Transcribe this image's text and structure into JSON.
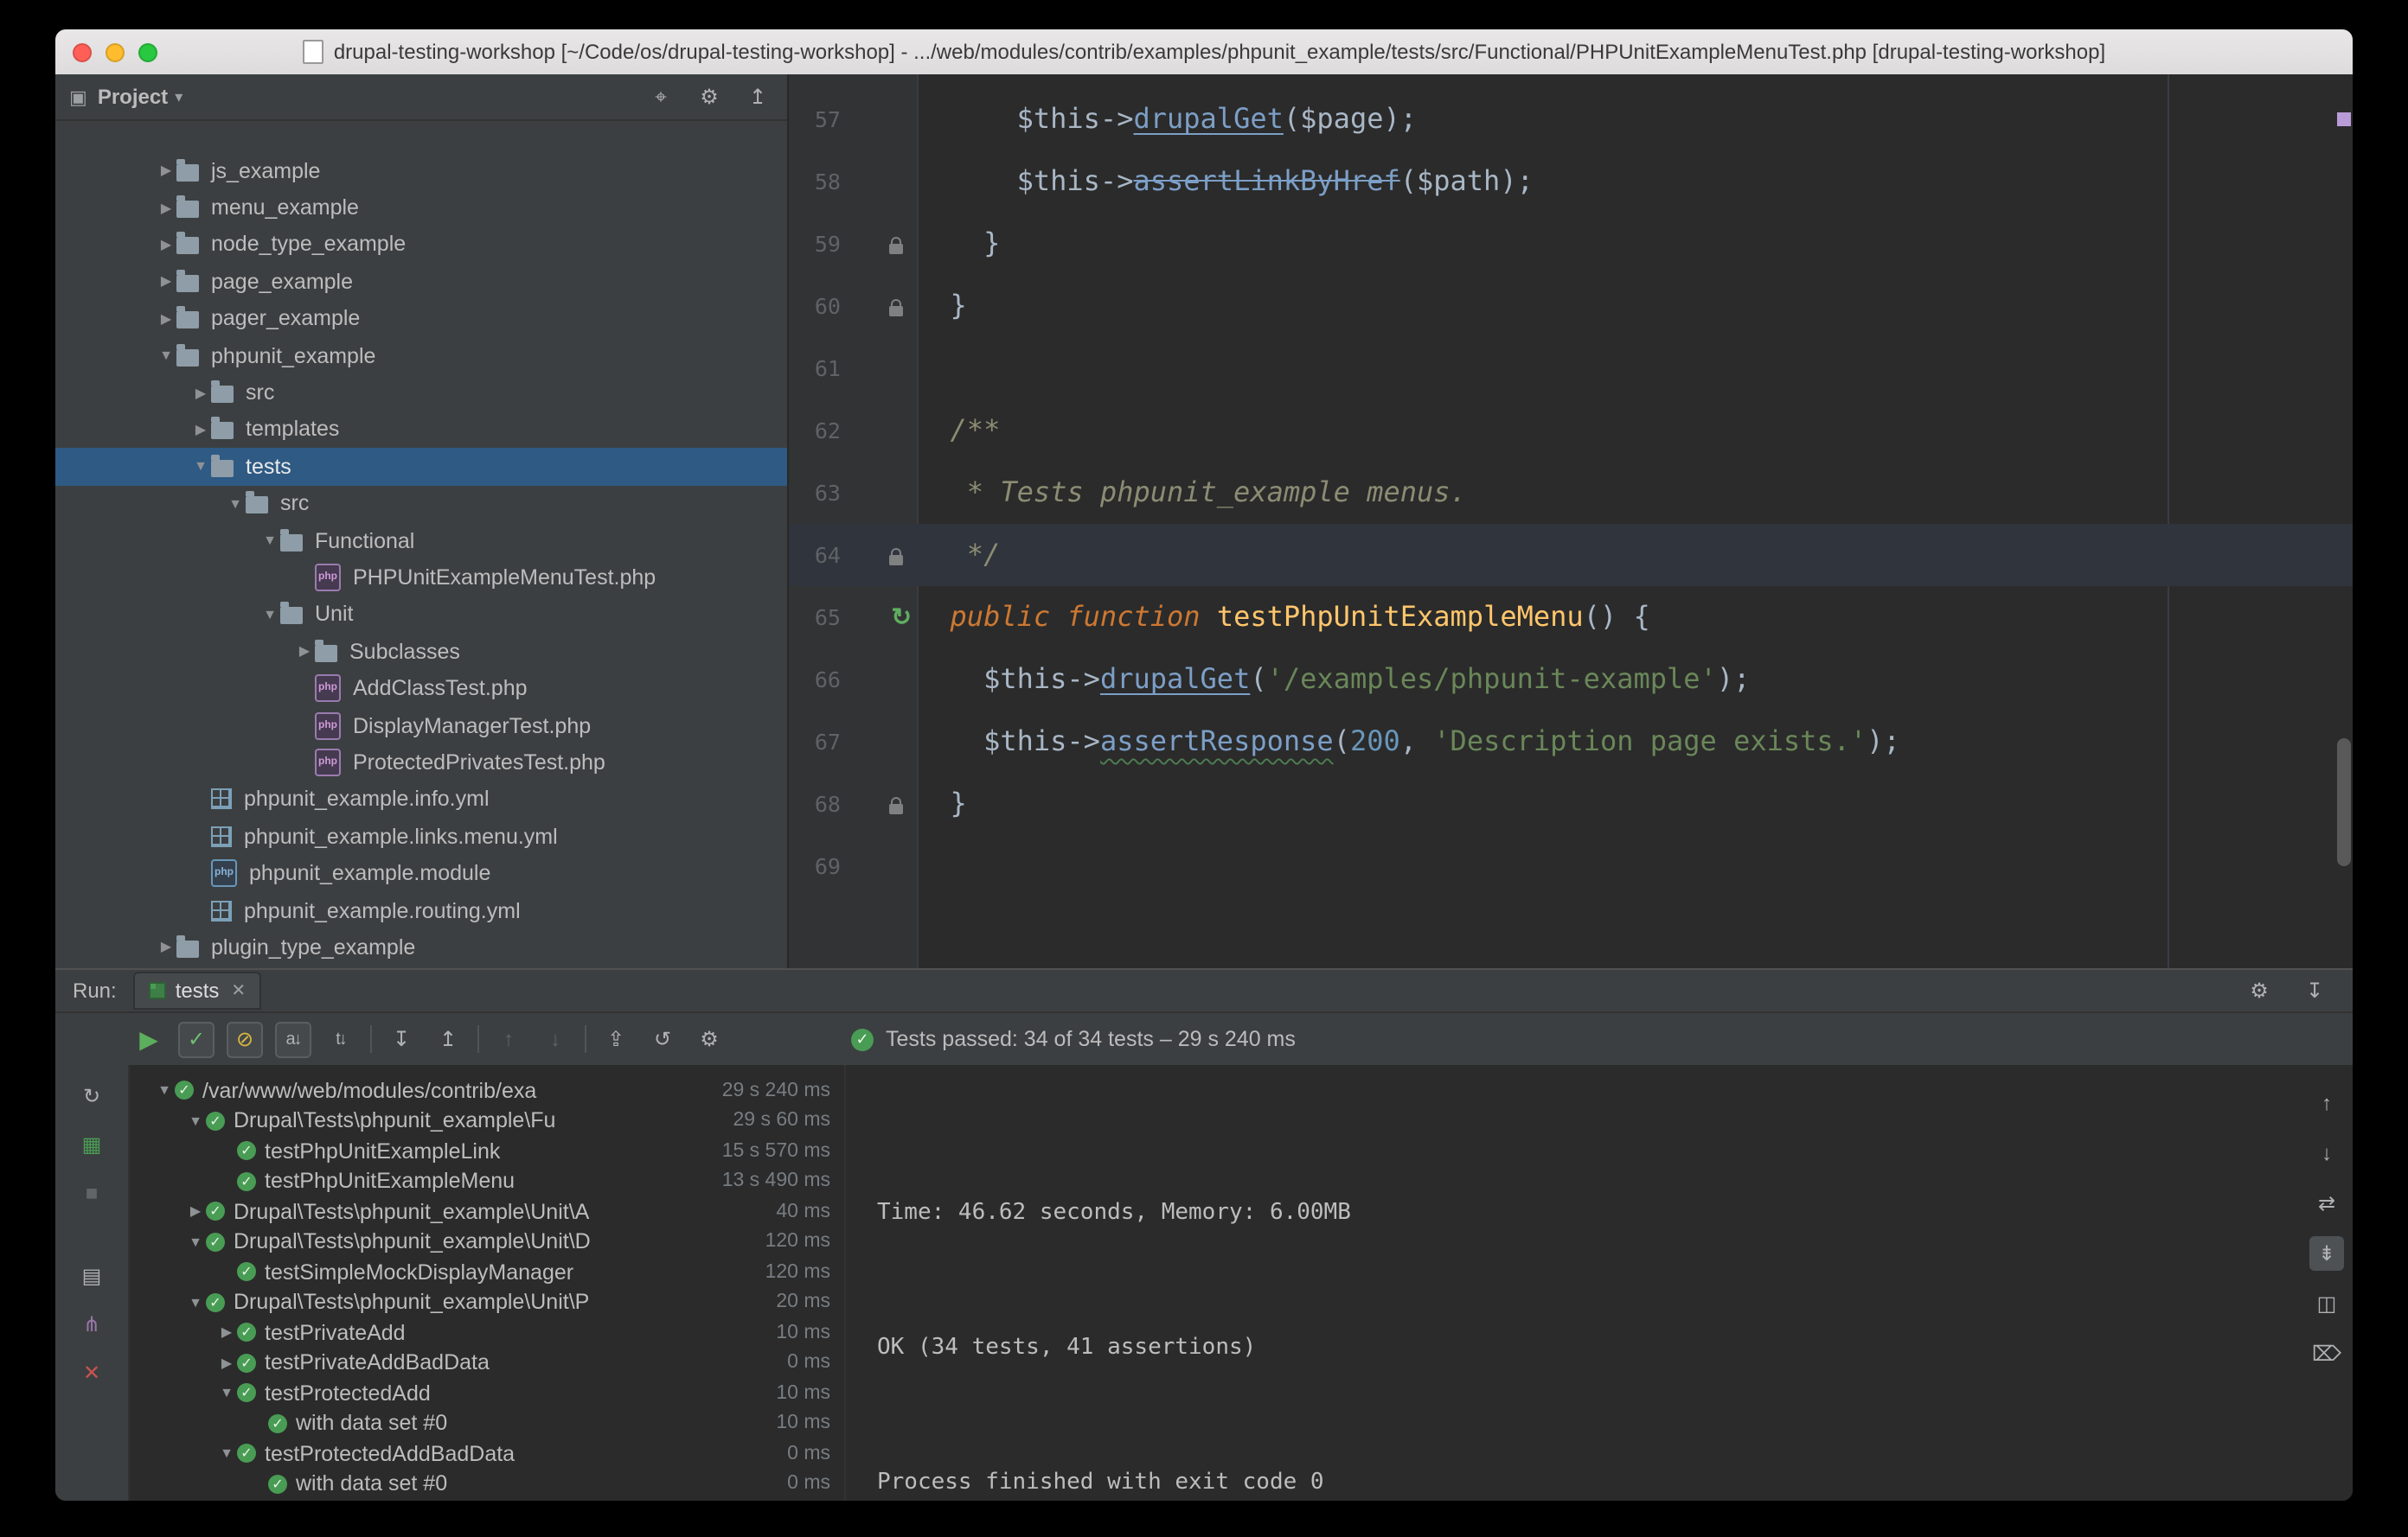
{
  "window": {
    "title": "drupal-testing-workshop [~/Code/os/drupal-testing-workshop] - .../web/modules/contrib/examples/phpunit_example/tests/src/Functional/PHPUnitExampleMenuTest.php [drupal-testing-workshop]"
  },
  "colors": {
    "traffic_close": "#ff5f57",
    "traffic_minimize": "#febc2e",
    "traffic_zoom": "#28c840",
    "selection_blue": "#2e5a84",
    "test_pass_green": "#499c54",
    "editor_bg": "#2b2b2b",
    "panel_bg": "#3c3f41",
    "error_stripe_mark": "#b99bd8"
  },
  "ui": {
    "arrow_open": "▼",
    "arrow_closed": "▶",
    "pass_icon": "✓",
    "php_badge": "php",
    "run_gutter_icon": "↻"
  },
  "project_panel": {
    "header": {
      "tool_icon": "▣",
      "title": "Project",
      "caret": "▾",
      "icons": [
        {
          "name": "locate-file-button",
          "glyph": "⌖"
        },
        {
          "name": "settings-button",
          "glyph": "⚙"
        },
        {
          "name": "collapse-all-button",
          "glyph": "↥"
        }
      ]
    },
    "tree": [
      {
        "label": "js_example",
        "depth": 0,
        "icon": "folder",
        "expand": "closed"
      },
      {
        "label": "menu_example",
        "depth": 0,
        "icon": "folder",
        "expand": "closed"
      },
      {
        "label": "node_type_example",
        "depth": 0,
        "icon": "folder",
        "expand": "closed"
      },
      {
        "label": "page_example",
        "depth": 0,
        "icon": "folder",
        "expand": "closed"
      },
      {
        "label": "pager_example",
        "depth": 0,
        "icon": "folder",
        "expand": "closed"
      },
      {
        "label": "phpunit_example",
        "depth": 0,
        "icon": "folder",
        "expand": "open"
      },
      {
        "label": "src",
        "depth": 1,
        "icon": "folder",
        "expand": "closed"
      },
      {
        "label": "templates",
        "depth": 1,
        "icon": "folder",
        "expand": "closed"
      },
      {
        "label": "tests",
        "depth": 1,
        "icon": "folder",
        "expand": "open",
        "selected": true
      },
      {
        "label": "src",
        "depth": 2,
        "icon": "folder",
        "expand": "open"
      },
      {
        "label": "Functional",
        "depth": 3,
        "icon": "folder",
        "expand": "open"
      },
      {
        "label": "PHPUnitExampleMenuTest.php",
        "depth": 4,
        "icon": "php",
        "expand": "none"
      },
      {
        "label": "Unit",
        "depth": 3,
        "icon": "folder",
        "expand": "open"
      },
      {
        "label": "Subclasses",
        "depth": 4,
        "icon": "folder",
        "expand": "closed"
      },
      {
        "label": "AddClassTest.php",
        "depth": 4,
        "icon": "php",
        "expand": "none"
      },
      {
        "label": "DisplayManagerTest.php",
        "depth": 4,
        "icon": "php",
        "expand": "none"
      },
      {
        "label": "ProtectedPrivatesTest.php",
        "depth": 4,
        "icon": "php",
        "expand": "none"
      },
      {
        "label": "phpunit_example.info.yml",
        "depth": 1,
        "icon": "yml",
        "expand": "none"
      },
      {
        "label": "phpunit_example.links.menu.yml",
        "depth": 1,
        "icon": "yml",
        "expand": "none"
      },
      {
        "label": "phpunit_example.module",
        "depth": 1,
        "icon": "module",
        "expand": "none"
      },
      {
        "label": "phpunit_example.routing.yml",
        "depth": 1,
        "icon": "yml",
        "expand": "none"
      },
      {
        "label": "plugin_type_example",
        "depth": 0,
        "icon": "folder",
        "expand": "closed"
      }
    ]
  },
  "editor": {
    "lines": [
      {
        "num": "57",
        "gutter": "",
        "segments": [
          [
            "      $this->",
            "p"
          ],
          [
            "drupalGet",
            "mu"
          ],
          [
            "($page);",
            "p"
          ]
        ]
      },
      {
        "num": "58",
        "gutter": "",
        "segments": [
          [
            "      $this->",
            "p"
          ],
          [
            "assertLinkByHref",
            "ms"
          ],
          [
            "($path);",
            "p"
          ]
        ]
      },
      {
        "num": "59",
        "gutter": "lock",
        "segments": [
          [
            "    }",
            "p"
          ]
        ]
      },
      {
        "num": "60",
        "gutter": "lock",
        "segments": [
          [
            "  }",
            "p"
          ]
        ]
      },
      {
        "num": "61",
        "gutter": "",
        "segments": []
      },
      {
        "num": "62",
        "gutter": "",
        "segments": [
          [
            "  /**",
            "c"
          ]
        ]
      },
      {
        "num": "63",
        "gutter": "",
        "segments": [
          [
            "   * Tests phpunit_example menus.",
            "c"
          ]
        ]
      },
      {
        "num": "64",
        "gutter": "lock",
        "caret": true,
        "segments": [
          [
            "   */",
            "c"
          ]
        ]
      },
      {
        "num": "65",
        "gutter": "run",
        "segments": [
          [
            "  ",
            "p"
          ],
          [
            "public function",
            "k"
          ],
          [
            " ",
            "p"
          ],
          [
            "testPhpUnitExampleMenu",
            "fn"
          ],
          [
            "() {",
            "p"
          ]
        ]
      },
      {
        "num": "66",
        "gutter": "",
        "segments": [
          [
            "    $this->",
            "p"
          ],
          [
            "drupalGet",
            "mu"
          ],
          [
            "(",
            "p"
          ],
          [
            "'/examples/phpunit-example'",
            "s"
          ],
          [
            ");",
            "p"
          ]
        ]
      },
      {
        "num": "67",
        "gutter": "",
        "segments": [
          [
            "    $this->",
            "p"
          ],
          [
            "assertResponse",
            "mw"
          ],
          [
            "(",
            "p"
          ],
          [
            "200",
            "n"
          ],
          [
            ", ",
            "p"
          ],
          [
            "'Description page exists.'",
            "s"
          ],
          [
            ");",
            "p"
          ]
        ]
      },
      {
        "num": "68",
        "gutter": "lock",
        "segments": [
          [
            "  }",
            "p"
          ]
        ]
      },
      {
        "num": "69",
        "gutter": "",
        "segments": []
      }
    ]
  },
  "run_panel": {
    "label": "Run:",
    "tab": {
      "label": "tests",
      "close": "✕"
    },
    "tabrow_icons": [
      {
        "name": "settings-button",
        "glyph": "⚙"
      },
      {
        "name": "hide-panel-button",
        "glyph": "↧"
      }
    ],
    "toolbar": {
      "status_icon": "✓",
      "status": "Tests passed: 34 of 34 tests – 29 s 240 ms",
      "icons": [
        {
          "name": "rerun-tests-button",
          "glyph": "▶",
          "cls": "play"
        },
        {
          "name": "show-passed-toggle",
          "glyph": "✓",
          "cls": "boxed chk"
        },
        {
          "name": "show-ignored-toggle",
          "glyph": "⊘",
          "cls": "boxed ign"
        },
        {
          "name": "sort-alphabetically-toggle",
          "glyph": "a↓",
          "cls": "boxed small-txt"
        },
        {
          "name": "sort-by-duration-toggle",
          "glyph": "t↓",
          "cls": "small-txt"
        },
        {
          "sep": true
        },
        {
          "name": "expand-all-button",
          "glyph": "↧"
        },
        {
          "name": "collapse-all-button",
          "glyph": "↥"
        },
        {
          "sep": true
        },
        {
          "name": "previous-failed-test-button",
          "glyph": "↑",
          "cls": "dim"
        },
        {
          "name": "next-failed-test-button",
          "glyph": "↓",
          "cls": "dim"
        },
        {
          "sep": true
        },
        {
          "name": "import-test-results-button",
          "glyph": "⇪"
        },
        {
          "name": "test-history-button",
          "glyph": "↺"
        },
        {
          "name": "run-settings-button",
          "glyph": "⚙"
        }
      ]
    },
    "left_strip_icons": [
      {
        "name": "rerun-button",
        "glyph": "↻"
      },
      {
        "name": "phpunit-settings-button",
        "glyph": "▦",
        "cls": "green"
      },
      {
        "name": "stop-button",
        "glyph": "■",
        "cls": "dim"
      },
      {
        "gap": true
      },
      {
        "name": "preview-button",
        "glyph": "▤"
      },
      {
        "name": "attach-debugger-button",
        "glyph": "⋔",
        "cls": "purple"
      },
      {
        "name": "close-button",
        "glyph": "✕",
        "cls": "red"
      }
    ],
    "tests_tree": [
      {
        "label": "/var/www/web/modules/contrib/exa",
        "depth": 0,
        "expand": "open",
        "dur": "29 s 240 ms"
      },
      {
        "label": "Drupal\\Tests\\phpunit_example\\Fu",
        "depth": 1,
        "expand": "open",
        "dur": "29 s 60 ms"
      },
      {
        "label": "testPhpUnitExampleLink",
        "depth": 2,
        "expand": "none",
        "dur": "15 s 570 ms"
      },
      {
        "label": "testPhpUnitExampleMenu",
        "depth": 2,
        "expand": "none",
        "dur": "13 s 490 ms"
      },
      {
        "label": "Drupal\\Tests\\phpunit_example\\Unit\\A",
        "depth": 1,
        "expand": "closed",
        "dur": "40 ms"
      },
      {
        "label": "Drupal\\Tests\\phpunit_example\\Unit\\D",
        "depth": 1,
        "expand": "open",
        "dur": "120 ms"
      },
      {
        "label": "testSimpleMockDisplayManager",
        "depth": 2,
        "expand": "none",
        "dur": "120 ms"
      },
      {
        "label": "Drupal\\Tests\\phpunit_example\\Unit\\P",
        "depth": 1,
        "expand": "open",
        "dur": "20 ms"
      },
      {
        "label": "testPrivateAdd",
        "depth": 2,
        "expand": "closed",
        "dur": "10 ms"
      },
      {
        "label": "testPrivateAddBadData",
        "depth": 2,
        "expand": "closed",
        "dur": "0 ms"
      },
      {
        "label": "testProtectedAdd",
        "depth": 2,
        "expand": "open",
        "dur": "10 ms"
      },
      {
        "label": "with data set #0",
        "depth": 3,
        "expand": "none",
        "dur": "10 ms"
      },
      {
        "label": "testProtectedAddBadData",
        "depth": 2,
        "expand": "open",
        "dur": "0 ms"
      },
      {
        "label": "with data set #0",
        "depth": 3,
        "expand": "none",
        "dur": "0 ms"
      }
    ],
    "console": {
      "lines": [
        "Time: 46.62 seconds, Memory: 6.00MB",
        "OK (34 tests, 41 assertions)",
        "Process finished with exit code 0"
      ]
    },
    "console_strip_icons": [
      {
        "name": "scroll-to-top-button",
        "glyph": "↑"
      },
      {
        "name": "scroll-to-bottom-button",
        "glyph": "↓"
      },
      {
        "name": "soft-wrap-toggle",
        "glyph": "⇄"
      },
      {
        "name": "scroll-to-end-toggle",
        "glyph": "⇟",
        "cls": "active"
      },
      {
        "name": "split-console-button",
        "glyph": "◫"
      },
      {
        "name": "clear-console-button",
        "glyph": "⌦"
      }
    ]
  }
}
